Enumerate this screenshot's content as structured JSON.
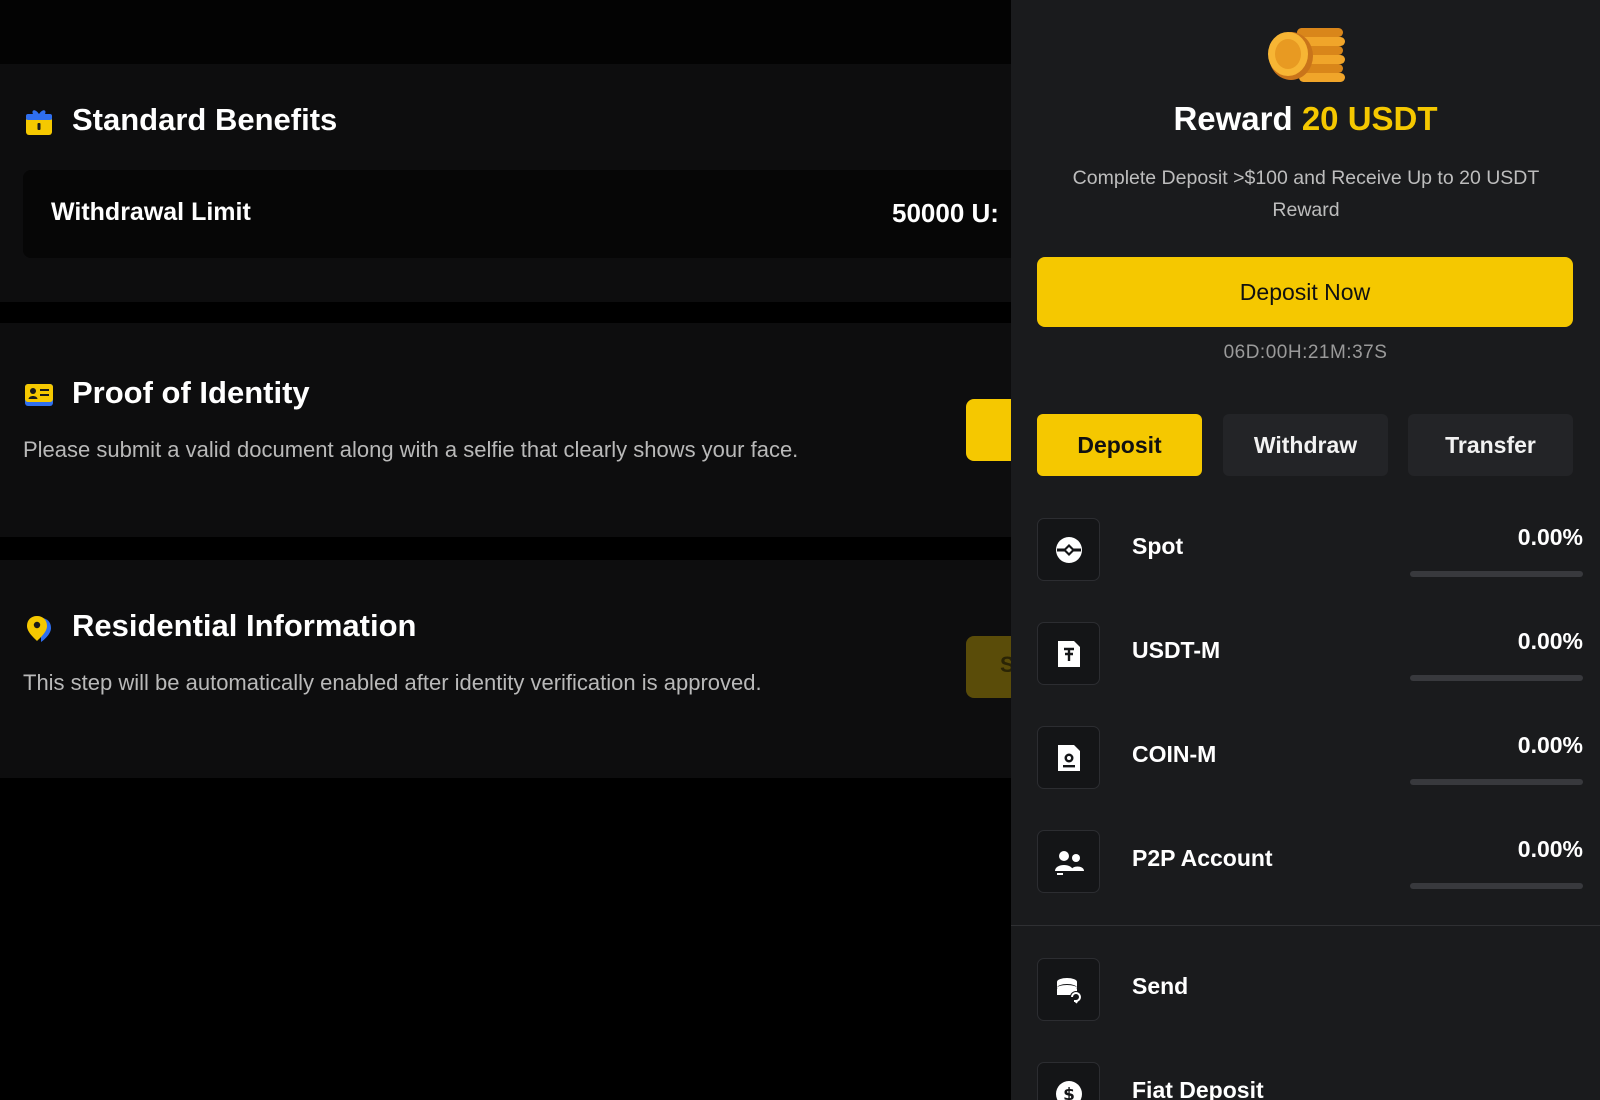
{
  "sections": {
    "benefits": {
      "title": "Standard Benefits",
      "withdrawal_label": "Withdrawal Limit",
      "withdrawal_value": "50000 U:"
    },
    "identity": {
      "title": "Proof of Identity",
      "description": "Please submit a valid document along with a selfie that clearly shows your face."
    },
    "residential": {
      "title": "Residential Information",
      "description": "This step will be automatically enabled after identity verification is approved.",
      "button_fragment": "S"
    }
  },
  "panel": {
    "reward_prefix": "Reward",
    "reward_amount": "20 USDT",
    "reward_description": "Complete Deposit >$100 and Receive Up to 20 USDT Reward",
    "deposit_now_label": "Deposit Now",
    "countdown": "06D:00H:21M:37S",
    "tabs": [
      {
        "label": "Deposit",
        "active": true
      },
      {
        "label": "Withdraw",
        "active": false
      },
      {
        "label": "Transfer",
        "active": false
      }
    ],
    "accounts": [
      {
        "name": "Spot",
        "percent": "0.00%",
        "progress": 0,
        "icon": "spot-icon"
      },
      {
        "name": "USDT-M",
        "percent": "0.00%",
        "progress": 0,
        "icon": "usdt-m-icon"
      },
      {
        "name": "COIN-M",
        "percent": "0.00%",
        "progress": 0,
        "icon": "coin-m-icon"
      },
      {
        "name": "P2P Account",
        "percent": "0.00%",
        "progress": 0,
        "icon": "p2p-icon"
      }
    ],
    "actions": [
      {
        "name": "Send",
        "icon": "send-icon"
      },
      {
        "name": "Fiat Deposit",
        "icon": "fiat-deposit-icon"
      }
    ]
  },
  "colors": {
    "accent": "#f5c800",
    "panel_bg": "#1a1b1d",
    "page_bg": "#000000",
    "card_bg": "#0d0d0e"
  }
}
